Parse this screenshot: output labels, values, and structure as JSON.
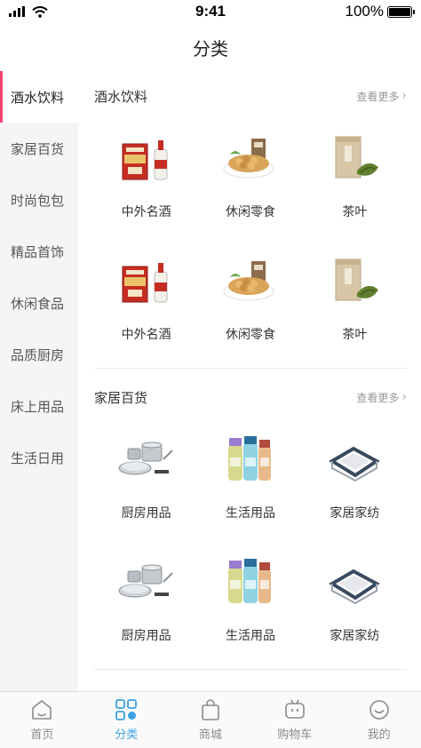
{
  "status": {
    "time": "9:41",
    "battery": "100%",
    "battery_level": 1.0
  },
  "nav": {
    "title": "分类"
  },
  "sidebar": {
    "items": [
      {
        "label": "酒水饮料",
        "active": true
      },
      {
        "label": "家居百货",
        "active": false
      },
      {
        "label": "时尚包包",
        "active": false
      },
      {
        "label": "精品首饰",
        "active": false
      },
      {
        "label": "休闲食品",
        "active": false
      },
      {
        "label": "品质厨房",
        "active": false
      },
      {
        "label": "床上用品",
        "active": false
      },
      {
        "label": "生活日用",
        "active": false
      }
    ]
  },
  "sections": [
    {
      "title": "酒水饮料",
      "more": "查看更多",
      "items": [
        {
          "label": "中外名酒",
          "icon": "liquor-bottle-icon"
        },
        {
          "label": "休闲零食",
          "icon": "snack-nuts-icon"
        },
        {
          "label": "茶叶",
          "icon": "tea-tin-icon"
        },
        {
          "label": "中外名酒",
          "icon": "liquor-bottle-icon"
        },
        {
          "label": "休闲零食",
          "icon": "snack-nuts-icon"
        },
        {
          "label": "茶叶",
          "icon": "tea-tin-icon"
        }
      ]
    },
    {
      "title": "家居百货",
      "more": "查看更多",
      "items": [
        {
          "label": "厨房用品",
          "icon": "cookware-icon"
        },
        {
          "label": "生活用品",
          "icon": "lotion-bottles-icon"
        },
        {
          "label": "家居家纺",
          "icon": "storage-box-icon"
        },
        {
          "label": "厨房用品",
          "icon": "cookware-icon"
        },
        {
          "label": "生活用品",
          "icon": "lotion-bottles-icon"
        },
        {
          "label": "家居家纺",
          "icon": "storage-box-icon"
        }
      ]
    }
  ],
  "tabbar": {
    "items": [
      {
        "label": "首页",
        "icon": "home-icon",
        "active": false
      },
      {
        "label": "分类",
        "icon": "category-grid-icon",
        "active": true
      },
      {
        "label": "商城",
        "icon": "shopping-bag-icon",
        "active": false
      },
      {
        "label": "购物车",
        "icon": "cart-icon",
        "active": false
      },
      {
        "label": "我的",
        "icon": "profile-smile-icon",
        "active": false
      }
    ]
  },
  "colors": {
    "accent": "#3aa2e0",
    "sidebar_indicator": "#f0436b",
    "sidebar_bg": "#f5f5f5"
  }
}
